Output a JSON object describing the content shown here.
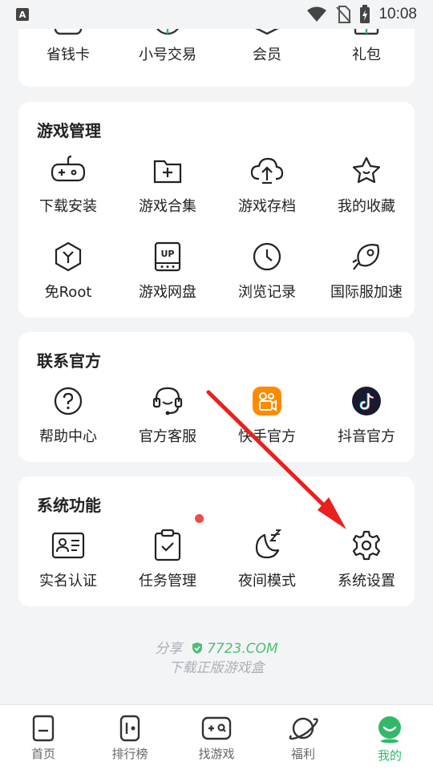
{
  "status_bar": {
    "time": "10:08",
    "app_indicator": "A"
  },
  "top_row": [
    {
      "label": "省钱卡",
      "icon": "savings-card-icon"
    },
    {
      "label": "小号交易",
      "icon": "account-trade-icon"
    },
    {
      "label": "会员",
      "icon": "member-icon"
    },
    {
      "label": "礼包",
      "icon": "gift-icon"
    }
  ],
  "game_management": {
    "title": "游戏管理",
    "items": [
      {
        "label": "下载安装",
        "icon": "gamepad-icon"
      },
      {
        "label": "游戏合集",
        "icon": "folder-plus-icon"
      },
      {
        "label": "游戏存档",
        "icon": "cloud-upload-icon"
      },
      {
        "label": "我的收藏",
        "icon": "star-icon"
      },
      {
        "label": "免Root",
        "icon": "hexagon-y-icon"
      },
      {
        "label": "游戏网盘",
        "icon": "up-disk-icon"
      },
      {
        "label": "浏览记录",
        "icon": "clock-icon"
      },
      {
        "label": "国际服加速",
        "icon": "rocket-icon"
      }
    ]
  },
  "contact_official": {
    "title": "联系官方",
    "items": [
      {
        "label": "帮助中心",
        "icon": "question-icon"
      },
      {
        "label": "官方客服",
        "icon": "headset-icon"
      },
      {
        "label": "快手官方",
        "icon": "kuaishou-icon"
      },
      {
        "label": "抖音官方",
        "icon": "douyin-icon"
      }
    ]
  },
  "system_functions": {
    "title": "系统功能",
    "items": [
      {
        "label": "实名认证",
        "icon": "id-card-icon"
      },
      {
        "label": "任务管理",
        "icon": "clipboard-check-icon"
      },
      {
        "label": "夜间模式",
        "icon": "moon-icon"
      },
      {
        "label": "系统设置",
        "icon": "gear-icon"
      }
    ]
  },
  "footer": {
    "share": "分享",
    "brand": "7723.COM",
    "tagline": "下载正版游戏盒"
  },
  "tabbar": [
    {
      "label": "首页",
      "icon": "home-icon",
      "active": false
    },
    {
      "label": "排行榜",
      "icon": "ranking-icon",
      "active": false
    },
    {
      "label": "找游戏",
      "icon": "find-game-icon",
      "active": false
    },
    {
      "label": "福利",
      "icon": "planet-icon",
      "active": false
    },
    {
      "label": "我的",
      "icon": "profile-icon",
      "active": true
    }
  ],
  "colors": {
    "accent": "#33b86a",
    "arrow": "#e8201e",
    "badge": "#ef4a4a"
  }
}
